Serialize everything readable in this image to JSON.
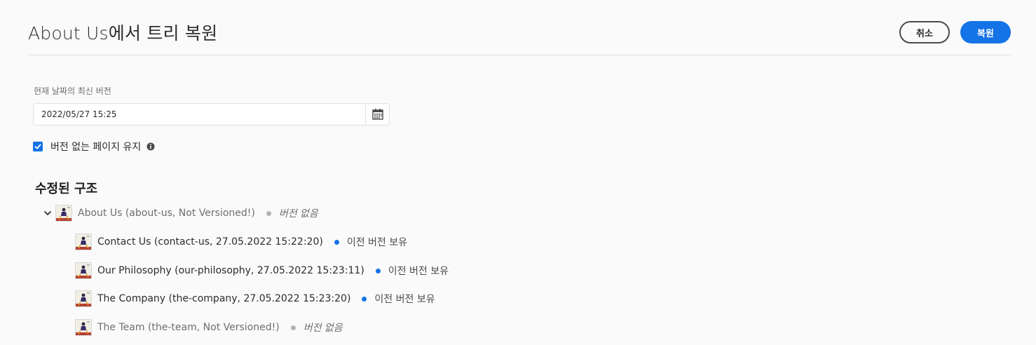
{
  "header": {
    "title": "About Us에서 트리 복원",
    "cancel_label": "취소",
    "restore_label": "복원"
  },
  "date_field": {
    "label": "현재 날짜의 최신 버전",
    "value": "2022/05/27 15:25",
    "icon": "calendar-icon"
  },
  "checkbox": {
    "label": "버전 없는 페이지 유지",
    "checked": true,
    "icon": "info-icon"
  },
  "section": {
    "title": "수정된 구조"
  },
  "tree": {
    "root": {
      "label": "About Us (about-us, Not Versioned!)",
      "status": "버전 없음",
      "status_color": "#b3b3b3"
    },
    "children": [
      {
        "label": "Contact Us (contact-us, 27.05.2022 15:22:20)",
        "status": "이전 버전 보유",
        "status_color": "#1473e6"
      },
      {
        "label": "Our Philosophy (our-philosophy, 27.05.2022 15:23:11)",
        "status": "이전 버전 보유",
        "status_color": "#1473e6"
      },
      {
        "label": "The Company (the-company, 27.05.2022 15:23:20)",
        "status": "이전 버전 보유",
        "status_color": "#1473e6"
      },
      {
        "label": "The Team (the-team, Not Versioned!)",
        "status": "버전 없음",
        "status_color": "#b3b3b3"
      }
    ]
  },
  "colors": {
    "accent": "#1473e6",
    "unversioned_dot": "#b3b3b3"
  }
}
